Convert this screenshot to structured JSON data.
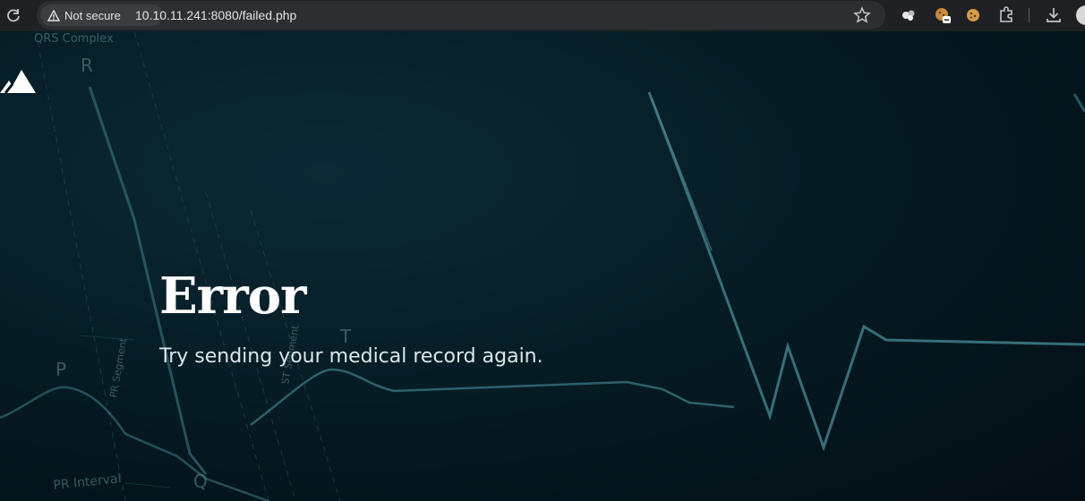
{
  "browser": {
    "security_label": "Not secure",
    "url": "10.10.11.241:8080/failed.php",
    "icons": [
      "reload-icon",
      "warning-icon",
      "bookmark-star-icon",
      "extension-icon",
      "cookie-icon",
      "puzzle-icon",
      "download-icon",
      "profile-avatar"
    ]
  },
  "page": {
    "heading": "Error",
    "message": "Try sending your medical record again."
  },
  "background_labels": {
    "qrs_complex": "QRS Complex",
    "r": "R",
    "p": "P",
    "q": "Q",
    "t": "T",
    "pr_segment": "PR Segment",
    "st_segment": "ST Segment",
    "pr_interval": "PR Interval"
  },
  "colors": {
    "background": "#05141c",
    "ecg_line": "#3f7f8a",
    "heading": "#ffffff",
    "message": "#dde6ea"
  }
}
